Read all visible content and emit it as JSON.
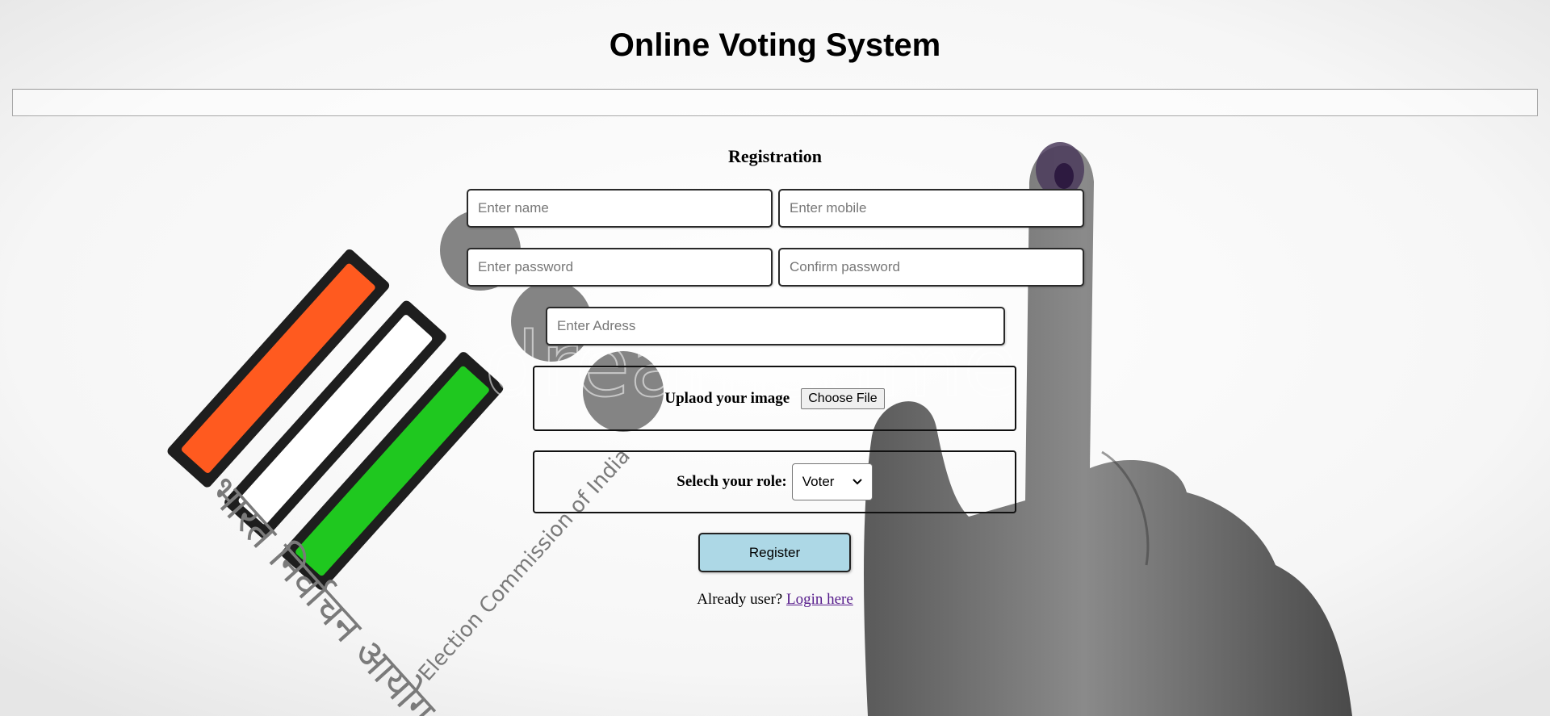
{
  "header": {
    "title": "Online Voting System"
  },
  "form": {
    "heading": "Registration",
    "name_placeholder": "Enter name",
    "mobile_placeholder": "Enter mobile",
    "password_placeholder": "Enter password",
    "confirm_placeholder": "Confirm password",
    "address_placeholder": "Enter Adress",
    "upload_label": "Uplaod your image",
    "file_button_label": "Choose File",
    "role_label": "Selech your role:",
    "role_selected": "Voter",
    "register_label": "Register",
    "already_text": "Already user?",
    "login_link": "Login here"
  },
  "background": {
    "logo_hindi_text": "भारत निर्वाचन आयोग",
    "logo_english_text": "Election Commission of India",
    "watermark": "dreamstime"
  },
  "colors": {
    "register_button": "#add8e6",
    "saffron": "#ff5a1f",
    "green": "#1fc81f",
    "link": "#551a8b"
  }
}
